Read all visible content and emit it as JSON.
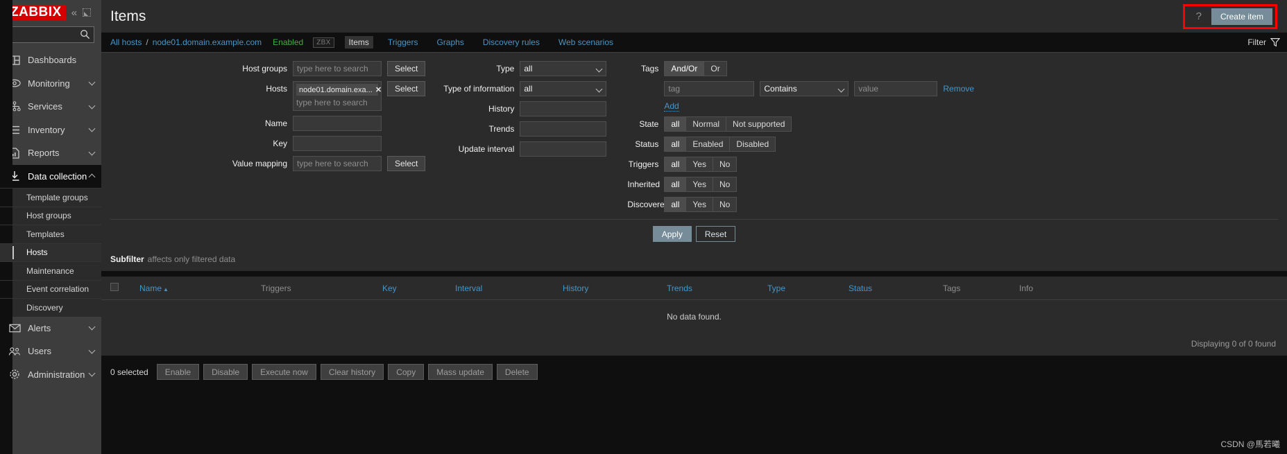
{
  "sidebar": {
    "logo": "ZABBIX",
    "collapse_icon": "chevron-double-left-icon",
    "hide_icon": "collapse-panel-icon",
    "search_placeholder": "",
    "search_icon": "search-icon",
    "items": [
      {
        "label": "Dashboards",
        "icon": "dashboard-icon",
        "has_chevron": false,
        "active": false
      },
      {
        "label": "Monitoring",
        "icon": "eye-icon",
        "has_chevron": true,
        "active": false
      },
      {
        "label": "Services",
        "icon": "services-tree-icon",
        "has_chevron": true,
        "active": false
      },
      {
        "label": "Inventory",
        "icon": "list-icon",
        "has_chevron": true,
        "active": false
      },
      {
        "label": "Reports",
        "icon": "report-icon",
        "has_chevron": true,
        "active": false
      },
      {
        "label": "Data collection",
        "icon": "download-icon",
        "has_chevron": true,
        "active": true
      },
      {
        "label": "Alerts",
        "icon": "envelope-icon",
        "has_chevron": true,
        "active": false
      },
      {
        "label": "Users",
        "icon": "users-icon",
        "has_chevron": true,
        "active": false
      },
      {
        "label": "Administration",
        "icon": "gear-icon",
        "has_chevron": true,
        "active": false
      }
    ],
    "data_collection_sub": [
      {
        "label": "Template groups",
        "active": false
      },
      {
        "label": "Host groups",
        "active": false
      },
      {
        "label": "Templates",
        "active": false
      },
      {
        "label": "Hosts",
        "active": true
      },
      {
        "label": "Maintenance",
        "active": false
      },
      {
        "label": "Event correlation",
        "active": false
      },
      {
        "label": "Discovery",
        "active": false
      }
    ]
  },
  "header": {
    "title": "Items",
    "help_icon": "question-mark-icon",
    "create_button": "Create item",
    "highlight_color": "#ff0000"
  },
  "breadcrumb": {
    "all_hosts": "All hosts",
    "separator": "/",
    "host": "node01.domain.example.com",
    "status": "Enabled",
    "status_color": "#3faf46",
    "agent_badge": "ZBX",
    "tabs": [
      {
        "label": "Items",
        "selected": true
      },
      {
        "label": "Triggers",
        "selected": false
      },
      {
        "label": "Graphs",
        "selected": false
      },
      {
        "label": "Discovery rules",
        "selected": false
      },
      {
        "label": "Web scenarios",
        "selected": false
      }
    ],
    "filter_label": "Filter",
    "filter_icon": "funnel-icon"
  },
  "filter": {
    "host_groups": {
      "label": "Host groups",
      "placeholder": "type here to search",
      "value": "",
      "select_button": "Select"
    },
    "hosts": {
      "label": "Hosts",
      "placeholder": "type here to search",
      "chip": "node01.domain.exa...",
      "chip_remove_icon": "close-icon",
      "select_button": "Select"
    },
    "name": {
      "label": "Name",
      "value": ""
    },
    "key": {
      "label": "Key",
      "value": ""
    },
    "value_mapping": {
      "label": "Value mapping",
      "placeholder": "type here to search",
      "value": "",
      "select_button": "Select"
    },
    "type": {
      "label": "Type",
      "value": "all",
      "options": [
        "all"
      ]
    },
    "type_of_information": {
      "label": "Type of information",
      "value": "all",
      "options": [
        "all"
      ]
    },
    "history": {
      "label": "History",
      "value": ""
    },
    "trends": {
      "label": "Trends",
      "value": ""
    },
    "update_interval": {
      "label": "Update interval",
      "value": ""
    },
    "tags": {
      "label": "Tags",
      "operator_options": [
        {
          "label": "And/Or",
          "selected": true
        },
        {
          "label": "Or",
          "selected": false
        }
      ],
      "tag_placeholder": "tag",
      "tag_value": "",
      "condition": "Contains",
      "condition_options": [
        "Contains"
      ],
      "value_placeholder": "value",
      "value_value": "",
      "remove_link": "Remove",
      "add_link": "Add"
    },
    "state": {
      "label": "State",
      "options": [
        {
          "label": "all",
          "selected": true
        },
        {
          "label": "Normal",
          "selected": false
        },
        {
          "label": "Not supported",
          "selected": false
        }
      ]
    },
    "status": {
      "label": "Status",
      "options": [
        {
          "label": "all",
          "selected": true
        },
        {
          "label": "Enabled",
          "selected": false
        },
        {
          "label": "Disabled",
          "selected": false
        }
      ]
    },
    "triggers": {
      "label": "Triggers",
      "options": [
        {
          "label": "all",
          "selected": true
        },
        {
          "label": "Yes",
          "selected": false
        },
        {
          "label": "No",
          "selected": false
        }
      ]
    },
    "inherited": {
      "label": "Inherited",
      "options": [
        {
          "label": "all",
          "selected": true
        },
        {
          "label": "Yes",
          "selected": false
        },
        {
          "label": "No",
          "selected": false
        }
      ]
    },
    "discovered": {
      "label": "Discovered",
      "options": [
        {
          "label": "all",
          "selected": true
        },
        {
          "label": "Yes",
          "selected": false
        },
        {
          "label": "No",
          "selected": false
        }
      ]
    },
    "apply_button": "Apply",
    "reset_button": "Reset"
  },
  "subfilter": {
    "title": "Subfilter",
    "note": "affects only filtered data"
  },
  "table": {
    "columns": [
      {
        "label": "Name",
        "link": true,
        "sorted": true,
        "sort_arrow": "▲"
      },
      {
        "label": "Triggers",
        "link": false,
        "sorted": false
      },
      {
        "label": "Key",
        "link": true,
        "sorted": false
      },
      {
        "label": "Interval",
        "link": true,
        "sorted": false
      },
      {
        "label": "History",
        "link": true,
        "sorted": false
      },
      {
        "label": "Trends",
        "link": true,
        "sorted": false
      },
      {
        "label": "Type",
        "link": true,
        "sorted": false
      },
      {
        "label": "Status",
        "link": true,
        "sorted": false
      },
      {
        "label": "Tags",
        "link": false,
        "sorted": false
      },
      {
        "label": "Info",
        "link": false,
        "sorted": false
      }
    ],
    "rows": [],
    "empty_message": "No data found.",
    "displaying": "Displaying 0 of 0 found"
  },
  "footer": {
    "selected_label": "0 selected",
    "buttons": [
      "Enable",
      "Disable",
      "Execute now",
      "Clear history",
      "Copy",
      "Mass update",
      "Delete"
    ]
  },
  "watermark": "CSDN @馬若曦"
}
